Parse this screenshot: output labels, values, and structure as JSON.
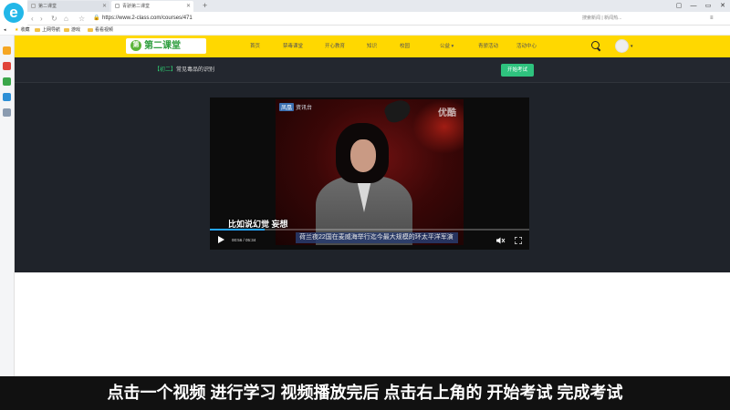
{
  "browser": {
    "logo_letter": "e",
    "tabs": [
      {
        "label": "第二课堂"
      },
      {
        "label": "青骄第二课堂"
      }
    ],
    "new_tab": "+",
    "window_controls": [
      "▢",
      "—",
      "▭",
      "✕"
    ],
    "url": "https://www.2-class.com/courses/471",
    "addr_right_text": "搜索新闻 | 新闻热...",
    "bookmarks": [
      {
        "label": "收藏"
      },
      {
        "label": "上网导航"
      },
      {
        "label": "游戏"
      },
      {
        "label": "看看视频"
      }
    ]
  },
  "site": {
    "logo_icon": "第",
    "logo_text": "第二课堂",
    "nav": [
      "首页",
      "禁毒课堂",
      "开心教育",
      "知识",
      "校园",
      "公益 ▾",
      "青骄活动",
      "活动中心"
    ],
    "avatar_caret": "▾"
  },
  "course": {
    "title_bracket": "【初二】",
    "title": "常见毒品的识别",
    "start_exam_label": "开始考试"
  },
  "video": {
    "station_box": "凤凰",
    "station_name": "资讯台",
    "watermark": "优酷",
    "subtitle": "比如说幻觉 妄想",
    "ticker": "荷兰夜22国在麦威海举行迄今最大规模的环太平洋军演",
    "current_time": "00:56",
    "duration": "05:34",
    "time_separator": " / ",
    "progress_fraction": 0.17
  },
  "caption": {
    "text": "点击一个视频 进行学习 视频播放完后 点击右上角的 开始考试 完成考试"
  },
  "colors": {
    "header_yellow": "#ffd800",
    "exam_green": "#2ec27e",
    "progress_blue": "#26a6ff",
    "dark_bg": "#1f232a"
  }
}
